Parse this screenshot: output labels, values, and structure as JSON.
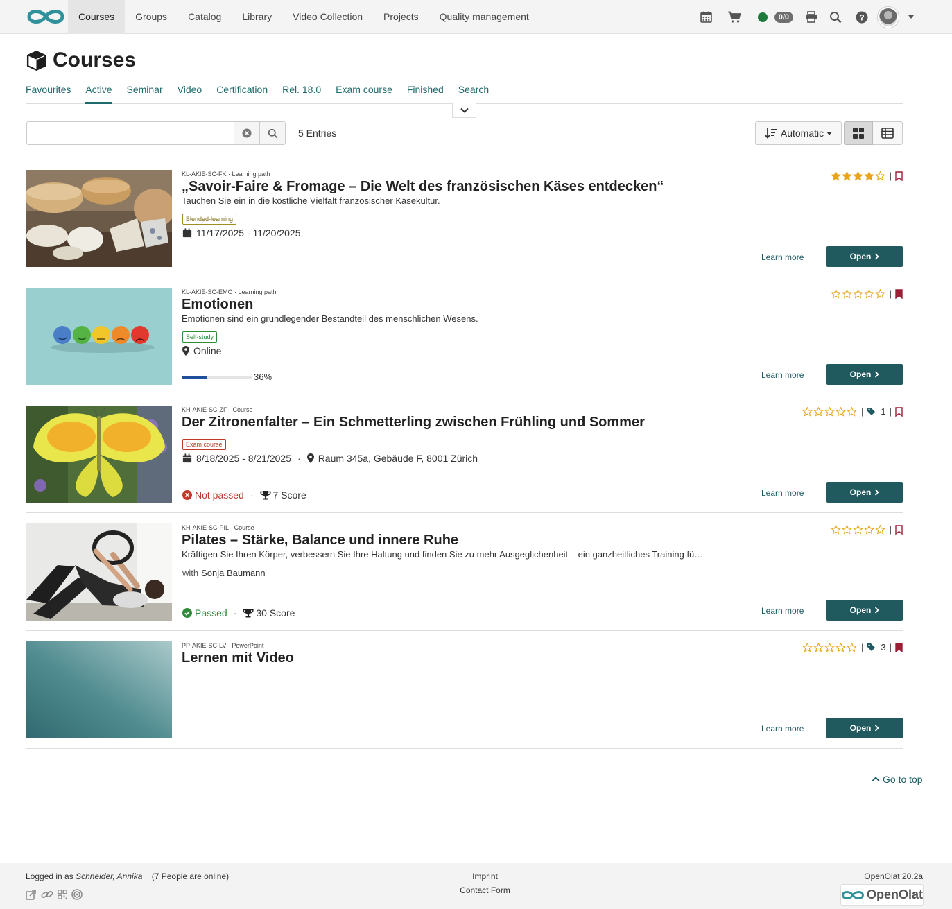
{
  "nav": {
    "items": [
      {
        "label": "Courses",
        "active": true
      },
      {
        "label": "Groups"
      },
      {
        "label": "Catalog"
      },
      {
        "label": "Library"
      },
      {
        "label": "Video Collection"
      },
      {
        "label": "Projects"
      },
      {
        "label": "Quality management"
      }
    ],
    "badge": "0/0",
    "status_color": "#1e7a3c"
  },
  "page": {
    "title": "Courses"
  },
  "tabs": [
    "Favourites",
    "Active",
    "Seminar",
    "Video",
    "Certification",
    "Rel. 18.0",
    "Exam course",
    "Finished",
    "Search"
  ],
  "active_tab": "Active",
  "search": {
    "value": "",
    "placeholder": ""
  },
  "entries_count": "5 Entries",
  "sort_label": "Automatic",
  "courses": [
    {
      "ref": "KL-AKIE-SC-FK · Learning path",
      "title": "„Savoir-Faire & Fromage – Die Welt des französischen Käses entdecken“",
      "description": "Tauchen Sie ein in die köstliche Vielfalt französischer Käsekultur.",
      "tag": "Blended-learning",
      "date": "11/17/2025 - 11/20/2025",
      "rating": 4,
      "bookmarked": false,
      "learn_more": "Learn more",
      "open": "Open"
    },
    {
      "ref": "KL-AKIE-SC-EMO · Learning path",
      "title": "Emotionen",
      "description": "Emotionen sind ein grundlegender Bestandteil des menschlichen Wesens.",
      "tag": "Self-study",
      "location": "Online",
      "progress": 36,
      "progress_label": "36%",
      "rating": 0,
      "bookmarked": true,
      "learn_more": "Learn more",
      "open": "Open"
    },
    {
      "ref": "KH-AKIE-SC-ZF · Course",
      "title": "Der Zitronenfalter – Ein Schmetterling zwischen Frühling und Sommer",
      "tag": "Exam course",
      "date": "8/18/2025 - 8/21/2025",
      "location": "Raum 345a, Gebäude F, 8001 Zürich",
      "status": "Not passed",
      "score": "7 Score",
      "tags_count": "1",
      "rating": 0,
      "bookmarked": false,
      "learn_more": "Learn more",
      "open": "Open"
    },
    {
      "ref": "KH-AKIE-SC-PIL · Course",
      "title": "Pilates – Stärke, Balance und innere Ruhe",
      "description": "Kräftigen Sie Ihren Körper, verbessern Sie Ihre Haltung und finden Sie zu mehr Ausgeglichenheit – ein ganzheitliches Training fü…",
      "with_label": "with",
      "author": "Sonja Baumann",
      "status": "Passed",
      "score": "30 Score",
      "rating": 0,
      "bookmarked": false,
      "learn_more": "Learn more",
      "open": "Open"
    },
    {
      "ref": "PP-AKIE-SC-LV · PowerPoint",
      "title": "Lernen mit Video",
      "tags_count": "3",
      "rating": 0,
      "bookmarked": true,
      "learn_more": "Learn more",
      "open": "Open"
    }
  ],
  "go_to_top": "Go to top",
  "footer": {
    "logged_prefix": "Logged in as",
    "user": "Schneider, Annika",
    "online": "(7 People are online)",
    "imprint": "Imprint",
    "contact": "Contact Form",
    "version": "OpenOlat 20.2a",
    "brand": "OpenOlat"
  },
  "colors": {
    "accent": "#1f6b6b",
    "open_button": "#20595e",
    "star": "#e8a51c",
    "bookmark": "#9b1f35",
    "failed": "#c0392b",
    "passed": "#2e8b3a"
  }
}
